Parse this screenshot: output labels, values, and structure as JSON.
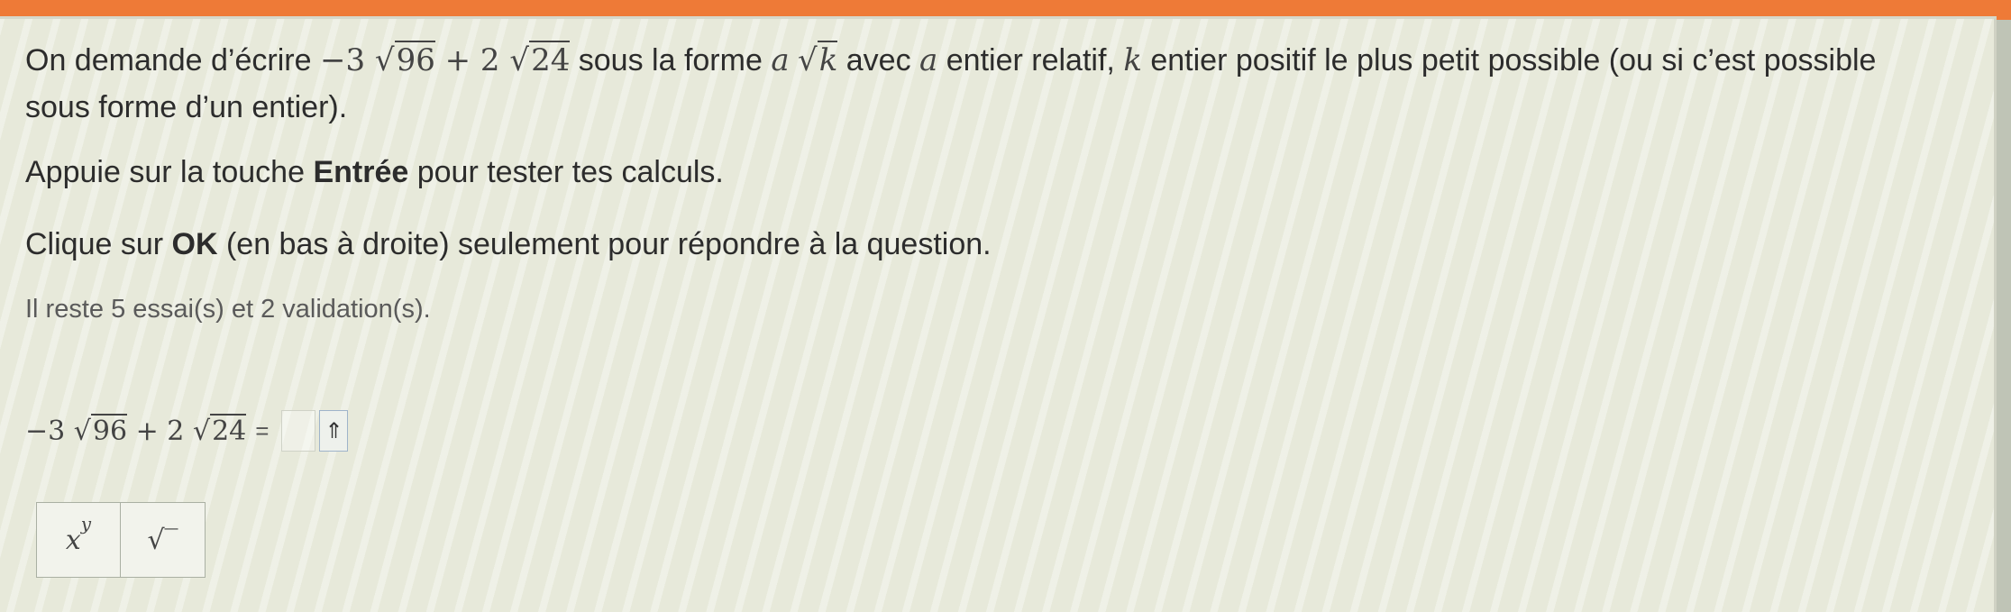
{
  "instructions": {
    "p1_before": "On demande d’écrire ",
    "expr_coef1": "−3",
    "expr_rad1": "96",
    "expr_plus": " + 2",
    "expr_rad2": "24",
    "p1_mid": " sous la forme ",
    "var_a": "a",
    "var_k": "k",
    "p1_after_form": " avec ",
    "p1_after_a": " entier relatif, ",
    "p1_end": " entier positif le plus petit possible (ou si c’est possible sous forme d’un entier).",
    "p2_before": "Appuie sur la touche ",
    "p2_key": "Entrée",
    "p2_after": " pour tester tes calculs.",
    "p3_before": "Clique sur ",
    "p3_key": "OK",
    "p3_after": " (en bas à droite) seulement pour répondre à la question."
  },
  "status": {
    "remaining": "Il reste 5 essai(s) et 2 validation(s)."
  },
  "equation": {
    "coef1": "−3",
    "rad1": "96",
    "plus": " + 2",
    "rad2": "24",
    "equals": "=",
    "answer_value": "",
    "submit_symbol": "⇑"
  },
  "keypad": {
    "power_base": "x",
    "power_exp": "y",
    "sqrt_symbol": "√‾"
  },
  "colors": {
    "top_band": "#ee7a37",
    "panel_bg": "#e7e9da",
    "text": "#2c2c2c"
  }
}
